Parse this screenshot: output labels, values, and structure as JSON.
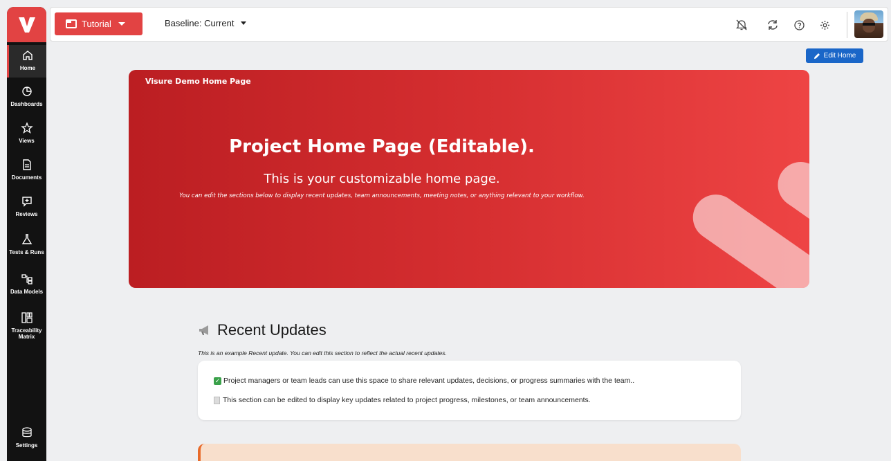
{
  "sidebar": {
    "logo": "V",
    "items": [
      {
        "label": "Home",
        "icon": "home-icon"
      },
      {
        "label": "Dashboards",
        "icon": "dashboard-icon"
      },
      {
        "label": "Views",
        "icon": "star-icon"
      },
      {
        "label": "Documents",
        "icon": "document-icon"
      },
      {
        "label": "Reviews",
        "icon": "review-icon"
      },
      {
        "label": "Tests & Runs",
        "icon": "flask-icon"
      },
      {
        "label": "Data Models",
        "icon": "data-model-icon"
      },
      {
        "label": "Traceability Matrix",
        "icon": "matrix-icon"
      },
      {
        "label": "Settings",
        "icon": "database-icon"
      }
    ]
  },
  "topbar": {
    "project": "Tutorial",
    "baseline": "Baseline: Current"
  },
  "edit_home": "Edit Home",
  "banner": {
    "small_title": "Visure Demo Home Page",
    "title": "Project Home Page (Editable).",
    "subtitle": "This is your customizable home page.",
    "note": "You can edit the sections below to display recent updates, team announcements, meeting notes, or anything relevant to your workflow."
  },
  "recent": {
    "title": "Recent Updates",
    "description": "This is an example Recent update. You can edit this section to reflect the actual recent updates.",
    "lines": [
      "Project managers or team leads can use this space to share relevant updates, decisions, or progress summaries with the team..",
      "This section can be edited to display key updates related to project progress, milestones, or team announcements."
    ]
  },
  "colors": {
    "accent": "#e24343",
    "primary_button": "#1a66c8",
    "sidebar_bg": "#121212"
  }
}
